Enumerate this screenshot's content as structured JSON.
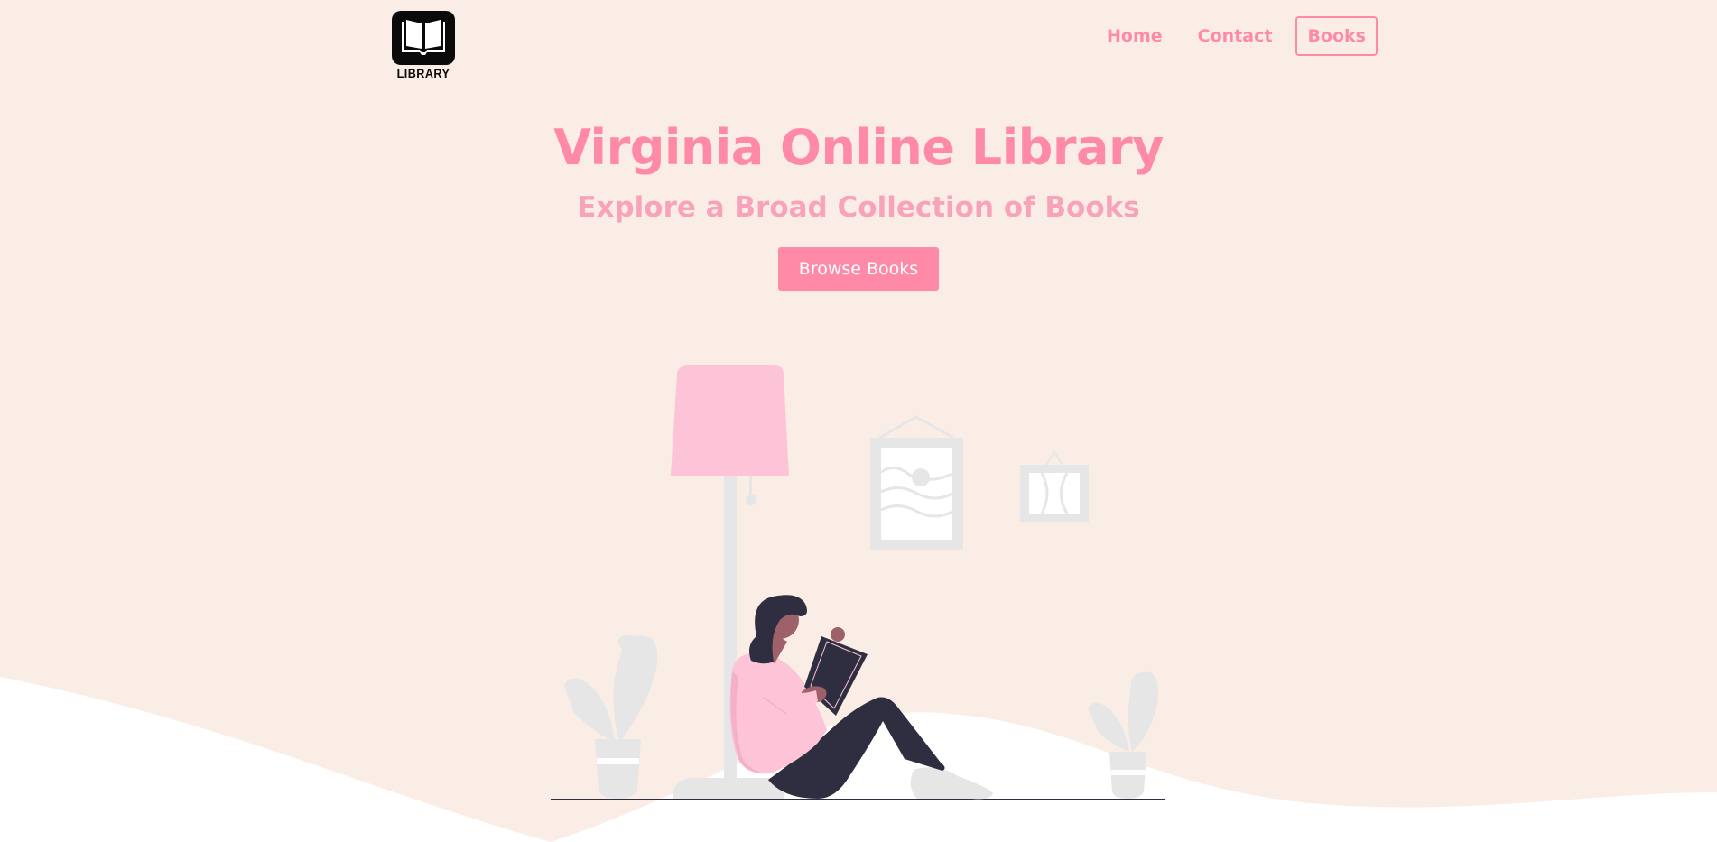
{
  "logo": {
    "text": "LIBRARY",
    "icon": "open-book-icon"
  },
  "nav": {
    "items": [
      {
        "label": "Home",
        "active": false
      },
      {
        "label": "Contact",
        "active": false
      },
      {
        "label": "Books",
        "active": true
      }
    ]
  },
  "hero": {
    "title": "Virginia Online Library",
    "subtitle": "Explore a Broad Collection of Books",
    "button_label": "Browse Books"
  },
  "colors": {
    "background": "#faede6",
    "accent": "#ff8aa7",
    "accent_light": "#f9a3ba",
    "lamp_shade": "#fcc4d6",
    "illustration_gray": "#e6e6e6",
    "dark": "#2f2e41"
  }
}
